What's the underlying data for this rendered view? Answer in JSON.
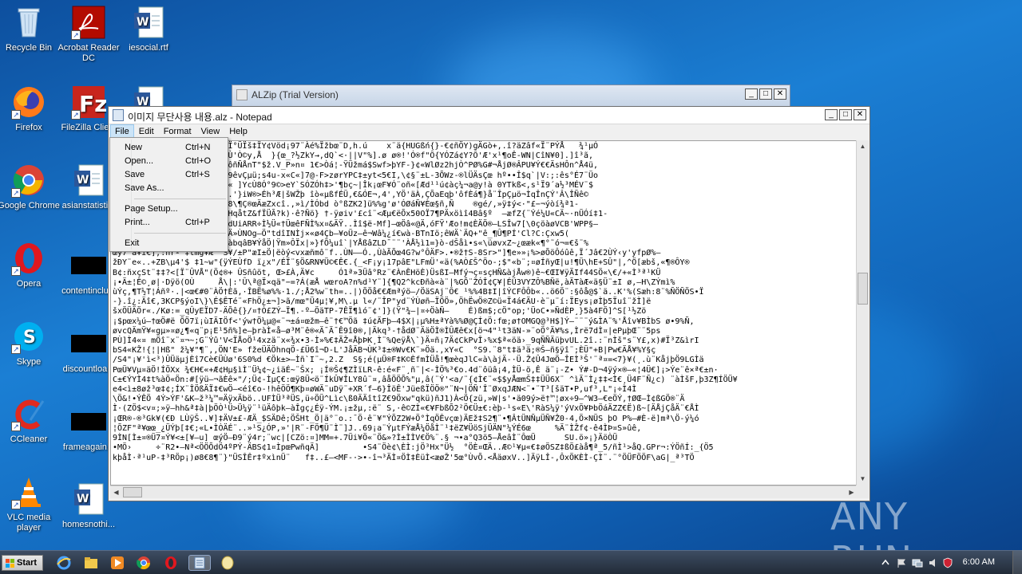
{
  "desktop_icons": [
    {
      "label": "Recycle Bin"
    },
    {
      "label": "Acrobat Reader DC"
    },
    {
      "label": "iesocial.rtf"
    },
    {
      "label": "Firefox"
    },
    {
      "label": "FileZilla Client"
    },
    {
      "label": ""
    },
    {
      "label": "Google Chrome"
    },
    {
      "label": "asianstatisti..."
    },
    {
      "label": "Opera"
    },
    {
      "label": "contentinclu..."
    },
    {
      "label": "Skype"
    },
    {
      "label": "discountloa..."
    },
    {
      "label": "CCleaner"
    },
    {
      "label": "frameagain..."
    },
    {
      "label": "VLC media player"
    },
    {
      "label": "homesnothi..."
    }
  ],
  "alzip": {
    "title": "ALZip (Trial Version)"
  },
  "notepad": {
    "title": "이미지 무단사용 내용.alz - Notepad",
    "menu": [
      "File",
      "Edit",
      "Format",
      "View",
      "Help"
    ],
    "text_lines": [
      "!      ÇëV-Ï_$DSä€¨Îebi¨Ï°ÜÏš‡ÏY¢Vöd¡97¨Àé%Ïžbœ¨D,h.ú    x¨ä{HUGßń{}-€¢ñÖY)gÄGò+,.î?äZâf«Ï¨PÝÅ   ¾¹µÓ",
      "EymY\"d¹ £Iy7€mÄUÉÕ$`·ÒfÙÙ'Ò©y,Å  }{œ_?½ZkY→‚dQ`<·||V\"%].ø ø®!'Ó®f\"Ô{YÓZá¢Y?Ô'Æ'x¹¶oÊ-WN|CîN¥0].]î³ã,",
      "ä8..|»-ls¨^XX!:ö¡, X-Ä;ßôñÑÅnT\"$ž.V_P»n¤ 1€>Òá¦-ŸÜžmá$Swf>þYF-}¢«WlØz2hjÒ^PØ%G#¬ÅjØ®ÂPU¥Ý€€ÄsHÔn^Å4ü,",
      "œZ¨†f7-¨ŸÏÜ-Rqul-gÓÜV¾\"99êvÇµü;s4u-x«C«]7@-F>zørYPC‡±yt<5€I,\\¢§¨±L-3ÕWz-®lÜÄsÇœ hº••Î$q`|V:;:ês°É7¨Üo",
      "¹UcD7»−−±V¨tÀÐRëÈ¤¥4ÖI K« ]YcÙ8Ó°9©>eY`SÓZÓh‡>'¶bç~|Îk¡œF¥Ó¨oñ«[Æd¹¹ú¢àç¼¬a@y!à 0YTkß<,s¹Ï9´a½³MÉV¨$",
      "Ñ-ÆÑf·wä.°J-©Z,V]ä\"Ü±¤MÀ.'}iW®>Éh³Æ|šWŽþ îò«µßfÉÜ,€&ÓE¬‚4',YÖ'äÀ,ÇÕaEqþ'ôfÈá¶}å¨ÎpÇµö¬ÌqÎnÇÝ'Â\\ÎÑê©",
      " È 3..ûBaîvEZ4ñ2SÖá$`èÖ18\\¶Ç®œÄæZxcî.,»ì/ÌÓbd ò°ßZK2]ü%%g'ø'ÓØáÑ¥Èœ§ñ,Ñ    ®gé/,»ÿ‡ý<·\"£−¬ýòí¾ª1-",
      "µm\"P%¡¢EyÑµ‡¨š4OK™'›ãQ¨|HqåtZ&fÏÜÃ?k)·ê?Ñö} †-ÿøiv'£cî¨<Æµ€ëÕx50OÏ7¶PÄxöìî4Bâ§º  —æfZ{¨Ýé¼U«CÄ~·nÜÓí‡1-",
      "<'v'|1ÑäÄûÂ»Æ3¬Ûuº¾€mu%8dUiARR÷Ì½Ü«†ÜœêFÑÌ%x¤&ÄŸ..Ìî$ë-Mf]—œÖâ«@Ä,óFŸ'Æo!m¢ÈÄÖ®—LSÎw7[\\0çöàøVCB'WPP§—",
      "-¬;ät$?=o}a7\"T&c¤àœ%Ýö÷¿Ä»ÙNOg—Ö\"tdîINÌj×«ø4Çb—¥oÜz—ê¬Wâ¼¿í€wà-BTnIö;êWÄ`ÄQ+\"ê_¶Û¶PÍ'Cl?C:Çxw5(",
      "]£Ý³Yóy ÀÕÌ Y€¥ Õ;ó|F¬z<àbqâB¥ÝåÖ|Ÿm»ÔÏx|»}fÕ¼uî`|YÅßâZLD¯¨¨'ÀÅ½ì1=}ò-dŠåì•s«\\üøvxZ~¿œæk«¶°˜ó¬=€š¨%",
      "œy7¨ã¥ì€],:ñrº'‡tmg¥Æ  S¥/±P\"æI±Ö|ëòý<vxæñmô¨f..ÙN——Ó.‚ÙàÃÕœ4G?w°ÔÄF>.•®ž†S-8Sr>\"]¶e»»¡%>øÕöÔóûê,Ï´Jâ€2ÙÝ‹y'yfpØ%—",
      "žÐY¨e«..+ZB\\µ4'$ ‡1~w\"{ÿÝEÙfD ï¿x\"/ÉÏ¨§Ö&RN¥Ü©€Ê€.{_<F¡y¡17pâE\"LFmÜ'«ä(%AÒ£Š^Öo-;$\"«b¨;¤øÍñyŒ|u!¶Ü\\hE+SÛ\"|,^Ö[æbš,«¶®ÔY®",
      "B¢:ñxçSt¨‡‡?<[Ï¨ÛVÅ\"(Ö¢®+ ÛSñûöt, Œ>£À,Ä¥c     Ó1ª»3Üâ°Rz¨€ÀnÊHöÈ)ÜsßI—Mfý¬ç¤sçHÑ&àjÅw®)ê~€ŒI¥ÿÄIf44SÖ«\\€/+«Ì³ª¹KÜ",
      "¡•Ä±¦Ê©¸ø|·Dÿö(OÙ     Å\\|:'Û\\ª@Ï×qä\"−=?Á(æÅ wœroA?n%d¹Y¨]{¶Q2^kcÐñà«à¨|%GÕ¨ŽÓÎ¢Ç¥|ÉÜ3VYZÔ%BÑë,àÄTàÆ«ä§Ü¨±I ø,—H\\ZÝmì%",
      "ùÝç,¶T½T¦Áñº·.|<œ€#0¨ÀÖ†Èã,·ÎBË%ø%%·1./;Å2%w¨th=..|)ÕÖå€€Æmªýö—/ÖäSAj¨Ô€ ¹%%4B‡I|îÝCFÔÔb«..ö6Ö¨:§ôå@$`ä..K'%(Sæh:8¨%ÑÖÑÖS•Ï",
      "-}.î¿:Äî€,3KCP§ýoI\\}\\É$ÊTé¨«FhÖ¿±¬]>ã/mœ\"Ü4µ¦¥,M\\.µ l«/¨ÎP\"yd¨ÝÙøñ–ÏÖÖ»,ÖhËwÖ®Z©ü«Ï4á€ÄU·è¨µ¨í:ÏEys¡øÌþ5Ïuî¨žÌ]ë",
      "šxÖÜÄÖr«./Kø:=_qÛyEÏD7-ÄÕê{}/¤†Ò£ZÝ—Ï¶.-º—ÖäTP-7ÊÏ¶ìó¨¢']}(Ÿ\"¾—|¤÷ÖàÑ—    É)ßm$;cÖ\"op;'ÜoC•»ÑdÈP¸}5à4FÖ]^S[¹½Zö",
      "¡$pœx¼ú—†œÖ#ë ÕÖ7ï¡ùIÄIÖf<'ýw†Ö¼µ@«¨¬±á¤œžm—ê¨†€™Öã ‡ú¢ÄFþ—4$X|¡µ%H±ªYà%%Ø@ÇÍ¢Ö:fœ;ø†OMGQ@³H$]Ý–¨¨¨ý&ÌA¨%'Åîv¥BÌbS ø•9%Ñ,",
      "øvcQÄmŸ¥«gµ»¤ø¿¶«q¨p¡E¹5ñ%]e—þràÌ«å—ø³M¨ê®«Ä¯Ä¯Ê9î0®,|Äkq³-†ådØ¨ÄäÖÌ®ÌÛÆê€x[ö¬4\"¹t3äN-»¨oÖ°Ä¥%s,Ìrë7dÌ¤|ePµþŒ¨¨5ps",
      "PÙ]Ì4«¤ mÖî¨x¨¤¬~;G¨Ýû'V<ÏÅoÖ¹4xzä¨x«¾x•3-Ì»%€‡ÄŽ«ÅþÞK¸Ì¨%QeÿÅ\\`}Ä¤ñ¡7Ä¢CkPvÎ›%x$ª«öä›_9qÑÑÄüþvUL.2î.:¨nÌš\"s¨Y£,x)#Ï³Z&ìrI",
      "bS4«KŽ!{¦|Hß\" ž¼¥\"¶¨,,ÖN'E» fžeÜÄÖhnqÖ-£Ü6î¬D-L'JåÄB¬ÙK³‡±®Wv€K¨»Öä.,xY«C  °S9.¨8\"t‡ä³ä;®Š—ñ§ÿî¨;ÈÜ\"+B|Pw€ÄÅ¥%Y§ç",
      "/S4\"¡¥'ì<³)ÛÜäµjÈî7Cè€ÜÙø'6S0%d €Ök±>—Ìñ`I¨~,2.Z  S§;é(µÜ®F‡K©ÈfmÌÜå!¶œèqJlC«à\\àjÄ-·Ü.Ž¢Û4JœÖ—ÎEÌ³Š'¨ª¤=<7}¥(¸.ù¨KåjþÖ9LGÌä",
      "PœÜ¥Vµ¤äÖ!ÍÖXx ¾€H€«+Æ¢Hµ§ìÌ¨Ü¼¢~¿iäÉ~¨Šx; ¡Í®Š¢¶ZÌïLR-ê:é«F¨¸ñ¨|<-ÌÖ%³€o.4d¨ôüâ¡4,ÌÜ-ö,Ê ä¨¡-Z• Ý#-D¬4ÿý×®—«¦4Ü€]¡>Ýe¨ê×ª€±n·",
      "C±€ÝYÌ4‡t%àÖ«Ön:#[ÿü—¬ãÈê×\"/;Ü¢-ÌµÇ€:œÿ8Ü<ö¨ÍkÛ¥ÎLY8û¨¤,âåÖÖÕ%\"µ,â(¨Ý'<a/¨{¢Ì€¨«$$yÅœmŠ‡‡ÜÜ6X¨ ^ìÄ¨Ì¿‡‡<Ì€¸Ü4F¨Ñ¿c) ¨àÌšF,þ3Z¶ÍÖÜ¥",
      "e4<ì±8øž³œ‡¢;ÍX¨ÎÖßÄÏ‡€wÖ—<éî€o-!hêÖÖ¶Kþ¤øWÄ¨uDÿ¨+XR´f—6}ÎöÊ'JüeßÏÖÖ®\"¨N¬|ÖÑ'Î¨ØxqJÆN<¨•¨T³[šäT•P,uf³,L\"¡÷Ì4Ì",
      "\\Ö&!•ÝÊÖ 4Ý>ÝF'&K—ž³¼™=ÄÿxÄbö..UFÌÜ³ªÜS,ü÷ÖÜ^Lìc\\ß0ÄÄîtîZ€9Öxw\"qkü)ñJ1)À<Ö{zü,»W|s'•ä09ý>ë†™¦øx÷9–^W3—€eÖÝ,†ØŒ—Ì¢ßGÖ®¨Ä",
      "Ì·(ZÖ$<v¤;»ÿ—hh&ª‡à|þÖÒ¹Ü>Ü¼ÿ¨¹üÄôþk—àÎgç¿Éÿ-ÝM.¡±žµ,:ë¨ S,·ê©ZÌ«€¥FbßÕ2²Ö€Ü±€:èþ-¹s«E\\'RàS¼ÿ'ýVxÖ¥ÞbÖáÄZZ€Ë)ß~[ÄÅjÇåÄ¨€ÅÌ",
      "¡ŒR®-®³Gk¥(€Ð LÙÿŠ..¥]‡ÄV±£-ÆÄ_$SÄDê;ÖŠHt_Ö|ä°¨o.:¯Ö·ê¨¥\"ÝÕZ2W+Ö°ÌqÖÊvçœ)ÄEž‡S2¶¨•¶ÂtÜNÑµÜÑ¥Ž0-4,Ö×NÜS þO P%—#È-ë]mª\\Ö-ý¼ó",
      "¦ÕZF\"ª¥œœ_¿ÜÝþ[‡€;«L•ÌÒÄÉ¨..»¹S¿ÓP,»'|R¨-FÖ¶Ü¨Ì¨]J..69¡a¨ÝµtFÝæÅ¼ÖåÌ¨¹‡ëZ¥ÜöSjÜÄN\"¼ÝÉ6œ     %Ä¨ÌŽf¢-ê4ÌÞ¤S»ûê,",
      "9ÌN[Ì±¤®Ü7¤Ý¥<±[¥–u] œýÖ—Ð9¨ý4r;¨wc|[CZö:¤]MM=+.7Üi¥Ö«¨Ö&»?Ì±ÌÌV€Ö%¨.§ ¬•a°Q3ö5—ÅeâÌ¨ÔœÜ      SU.ö»¡}ÄöÒÜ",
      "•MÖ›     ÷¨R2•—Nª<ÖÖÕdÖ4ºPÝ-ÄBS¢1¤ÌpœPwñqÄ]         •S4¨Öè¢\\ÈÌ:jÖ³Hx\"Ü½  °ÖÈ¤ŒÄ..Æ©¹¥µ«€‡øÖSZ‡ßÖ£àå¶ª_5/ñÌ¹>åQ.GPr¬:ÝÖñÍ:_{Ö5",
      "kþåÌ·ª¹uP-‡³RÖp¡)ø8€8¶¨}\"ÜSÎÊr‡ºxìnÜ¨   f‡..£–<MF-·>•-î¬³ÄÌ¤ÖÌ‡ÈüÌ<æøŽ'5œ°ÙvÕ.<ÅäøxV..]ÄÿLÎ-,ÔxÖKÈÌ-ÇÌ¨.¨°ÖÜFÖÖF\\aG|_ª³TÖ"
    ]
  },
  "file_menu": {
    "items": [
      {
        "label": "New",
        "shortcut": "Ctrl+N"
      },
      {
        "label": "Open...",
        "shortcut": "Ctrl+O"
      },
      {
        "label": "Save",
        "shortcut": "Ctrl+S"
      },
      {
        "label": "Save As...",
        "shortcut": ""
      },
      {
        "label": "Page Setup...",
        "shortcut": ""
      },
      {
        "label": "Print...",
        "shortcut": "Ctrl+P"
      },
      {
        "label": "Exit",
        "shortcut": ""
      }
    ]
  },
  "watermark": {
    "text": "ANY RUN"
  },
  "taskbar": {
    "start_label": "Start",
    "clock": "6:00 AM"
  }
}
